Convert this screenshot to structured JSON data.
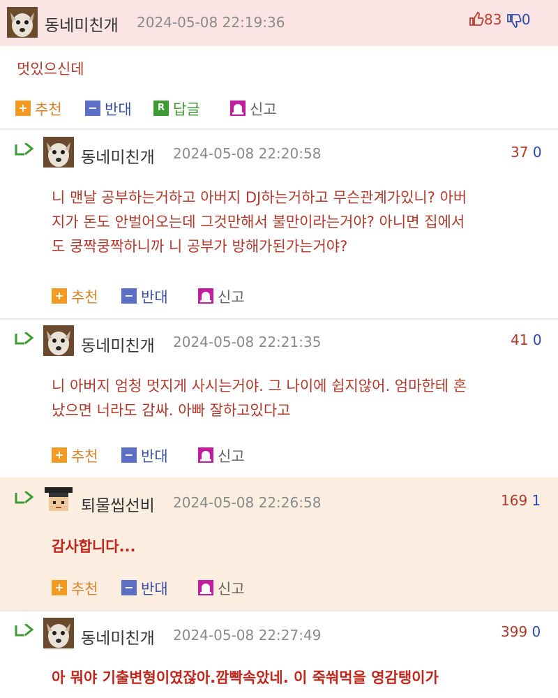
{
  "comments": [
    {
      "nickname": "동네미친개",
      "date": "2024-05-08 22:19:36",
      "up": "83",
      "down": "0",
      "text": "멋있으신데",
      "actions": {
        "recommend": "추천",
        "oppose": "반대",
        "reply": "답글",
        "report": "신고"
      }
    },
    {
      "nickname": "동네미친개",
      "date": "2024-05-08 22:20:58",
      "up": "37",
      "down": "0",
      "lines": [
        "니 맨날 공부하는거하고 아버지 DJ하는거하고 무슨관계가있니? 아버",
        "지가 돈도 안벌어오는데 그것만해서 불만이라는거야? 아니면 집에서",
        "도 쿵짝쿵짝하니까 니 공부가 방해가된가는거야?"
      ],
      "actions": {
        "recommend": "추천",
        "oppose": "반대",
        "report": "신고"
      }
    },
    {
      "nickname": "동네미친개",
      "date": "2024-05-08 22:21:35",
      "up": "41",
      "down": "0",
      "lines": [
        "니 아버지 엄청 멋지게 사시는거야. 그 나이에 쉽지않어. 엄마한테 혼",
        "났으면 너라도 감싸. 아빠 잘하고있다고"
      ],
      "actions": {
        "recommend": "추천",
        "oppose": "반대",
        "report": "신고"
      }
    },
    {
      "nickname": "퇴물씹선비",
      "date": "2024-05-08 22:26:58",
      "up": "169",
      "down": "1",
      "text": "감사합니다...",
      "actions": {
        "recommend": "추천",
        "oppose": "반대",
        "report": "신고"
      }
    },
    {
      "nickname": "동네미친개",
      "date": "2024-05-08 22:27:49",
      "up": "399",
      "down": "0",
      "text": "아 뭐야 기출변형이였잖아.깜빡속았네. 이 죽쒀먹을 영감탱이가"
    }
  ],
  "colors": {
    "top_bg": "#fbe4e4",
    "author_bg": "#fbeee0",
    "text_red": "#b0392b",
    "score_red": "#b0392b",
    "score_blue": "#2c4aa6",
    "reply_green": "#3d9b34"
  },
  "icons": {
    "thumb_up": "thumb-up-icon",
    "thumb_down": "thumb-down-icon",
    "reply_arrow": "reply-arrow-icon",
    "recommend": "plus-icon",
    "oppose": "minus-icon",
    "reply": "reply-r-icon",
    "report": "siren-icon"
  }
}
